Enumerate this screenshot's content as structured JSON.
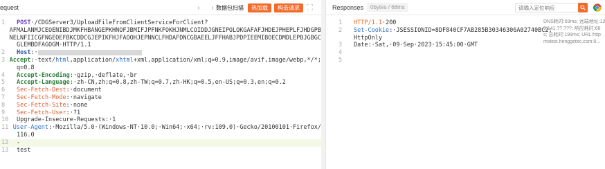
{
  "request": {
    "title": "equest",
    "nav_back": "‹",
    "nav_forward": "›",
    "scan_button": "数据包扫描",
    "hot_button": "热加载",
    "build_button": "构造请求",
    "expand_icon": "expand-icon",
    "lines": [
      {
        "num": "1",
        "parts": [
          {
            "t": "POST",
            "c": "k-purple"
          },
          {
            "t": "·/CDGServer3/UploadFileFromClientServiceForClient?",
            "c": ""
          }
        ]
      },
      {
        "num": "",
        "parts": [
          {
            "t": "AFMALANMJCEOENIBDJMKFHBANGEPKHNOFJBMIFJPFNKFOKHJNMLCOIDDJGNEIPOLOKGAFAFJHDEJPHEPLFJHDGPB",
            "c": ""
          }
        ]
      },
      {
        "num": "",
        "parts": [
          {
            "t": "NELNFIICGFNGEOEFBKCDDCGJEPIKFHJFAOOHJEPNNCLFHDAFDNCGBAEELJFFHABJPDPIEEMIBOECDMDLEPBJGBGC",
            "c": ""
          }
        ]
      },
      {
        "num": "",
        "parts": [
          {
            "t": "GLEMBDFAGOGM·HTTP/1.1",
            "c": ""
          }
        ]
      },
      {
        "num": "2",
        "parts": [
          {
            "t": "Host",
            "c": "k-navy"
          },
          {
            "t": ":·",
            "c": ""
          },
          {
            "t": "[redacted]",
            "c": "mask"
          }
        ]
      },
      {
        "num": "3",
        "parts": [
          {
            "t": "Accept",
            "c": "k-green"
          },
          {
            "t": ":·text/",
            "c": ""
          },
          {
            "t": "html",
            "c": "k-blue"
          },
          {
            "t": ",application/",
            "c": ""
          },
          {
            "t": "xhtml",
            "c": "k-blue"
          },
          {
            "t": "+xml,application/xml;q=0.9,image/avif,image/webp,*/*;",
            "c": ""
          }
        ]
      },
      {
        "num": "",
        "parts": [
          {
            "t": "q=0.8",
            "c": ""
          }
        ]
      },
      {
        "num": "4",
        "parts": [
          {
            "t": "Accept-Encoding",
            "c": "k-green"
          },
          {
            "t": ":·gzip,·deflate,·br",
            "c": ""
          }
        ]
      },
      {
        "num": "5",
        "parts": [
          {
            "t": "Accept-Language",
            "c": "k-green"
          },
          {
            "t": ":·zh-CN,zh;q=0.8,zh-TW;q=0.7,zh-HK;q=0.5,en-US;q=0.3,en;q=0.2",
            "c": ""
          }
        ]
      },
      {
        "num": "6",
        "parts": [
          {
            "t": "Sec-Fetch-Dest",
            "c": "k-redorange"
          },
          {
            "t": ":·document",
            "c": ""
          }
        ]
      },
      {
        "num": "7",
        "parts": [
          {
            "t": "Sec-Fetch-Mode",
            "c": "k-redorange"
          },
          {
            "t": ":·navigate",
            "c": ""
          }
        ]
      },
      {
        "num": "8",
        "parts": [
          {
            "t": "Sec-Fetch-Site",
            "c": "k-redorange"
          },
          {
            "t": ":·none",
            "c": ""
          }
        ]
      },
      {
        "num": "9",
        "parts": [
          {
            "t": "Sec-Fetch-User",
            "c": "k-redorange"
          },
          {
            "t": ":·?1",
            "c": ""
          }
        ]
      },
      {
        "num": "10",
        "parts": [
          {
            "t": "Upgrade-Insecure-Requests:·1",
            "c": ""
          }
        ]
      },
      {
        "num": "11",
        "parts": [
          {
            "t": "User-Agent",
            "c": "k-blue"
          },
          {
            "t": ":·Mozilla/5.0·(Windows·NT·10.0;·Win64;·x64;·rv:109.0)·Gecko/20100101·Firefox/",
            "c": ""
          }
        ]
      },
      {
        "num": "",
        "parts": [
          {
            "t": "116.0",
            "c": ""
          }
        ]
      },
      {
        "num": "12",
        "parts": [
          {
            "t": "-",
            "c": ""
          }
        ],
        "highlight": true
      },
      {
        "num": "13",
        "parts": [
          {
            "t": "test",
            "c": ""
          }
        ]
      }
    ]
  },
  "response": {
    "title": "Responses",
    "meta": "0bytes / 68ms",
    "search_placeholder": "请输入定位响应",
    "search_icon": "search-icon",
    "browser_icon": "chrome-icon",
    "info_lines": [
      "DNS耗时:69ms; 远端地址:12",
      "3.141.??.???; 响应耗时:68",
      "s; 总耗时:199ms; URL:http",
      "mstest.henggetec.com:8..."
    ],
    "lines": [
      {
        "num": "1",
        "parts": [
          {
            "t": "HTTP/1.1",
            "c": "k-orange"
          },
          {
            "t": "·200",
            "c": ""
          }
        ]
      },
      {
        "num": "2",
        "parts": [
          {
            "t": "Set-Cookie",
            "c": "k-blue"
          },
          {
            "t": ":·JSESSIONID=8DF840CF7AB285B30346306A02740BC2;",
            "c": ""
          }
        ]
      },
      {
        "num": "",
        "parts": [
          {
            "t": "HttpOnly",
            "c": ""
          }
        ]
      },
      {
        "num": "3",
        "parts": [
          {
            "t": "Date:·Sat,·09·Sep·2023·15:45:00·GMT",
            "c": ""
          }
        ]
      },
      {
        "num": "4",
        "parts": [
          {
            "t": "",
            "c": ""
          }
        ]
      },
      {
        "num": "5",
        "parts": [
          {
            "t": "",
            "c": ""
          }
        ]
      }
    ]
  }
}
